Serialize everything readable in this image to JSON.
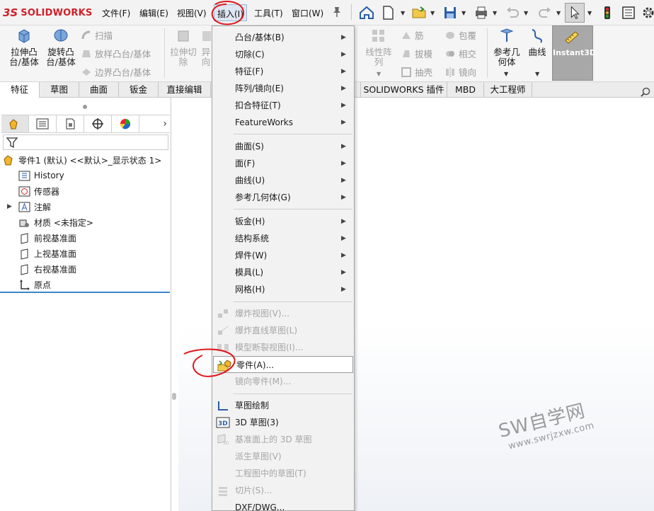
{
  "app": {
    "logo_ds": "3S",
    "logo_word": "SOLIDWORKS"
  },
  "menubar": {
    "items": [
      "文件(F)",
      "编辑(E)",
      "视图(V)",
      "插入(I)",
      "工具(T)",
      "窗口(W)"
    ],
    "active": "插入(I)"
  },
  "ribbon": {
    "extrude_boss": "拉伸凸\n台/基体",
    "revolve_boss": "旋转凸\n台/基体",
    "sweep": "扫描",
    "loft": "放样凸台/基体",
    "boundary": "边界凸台/基体",
    "extrude_cut": "拉伸切\n除",
    "hidden_cut": "异\n向",
    "linear_pattern": "线性阵\n列",
    "rib": "筋",
    "wrap": "包覆",
    "draft": "拔模",
    "intersect": "相交",
    "shell": "抽壳",
    "mirror": "镜向",
    "ref_geometry": "参考几\n何体",
    "curves": "曲线",
    "instant3d": "Instant3D"
  },
  "tabs": [
    "特征",
    "草图",
    "曲面",
    "钣金",
    "直接编辑",
    "",
    "SOLIDWORKS 插件",
    "MBD",
    "大工程师"
  ],
  "tree": {
    "root": "零件1 (默认) <<默认>_显示状态 1>",
    "nodes": [
      "History",
      "传感器",
      "注解",
      "材质 <未指定>",
      "前视基准面",
      "上视基准面",
      "右视基准面",
      "原点"
    ]
  },
  "insert_menu": {
    "groups": [
      [
        {
          "label": "凸台/基体(B)",
          "submenu": true,
          "enabled": true
        },
        {
          "label": "切除(C)",
          "submenu": true,
          "enabled": true
        },
        {
          "label": "特征(F)",
          "submenu": true,
          "enabled": true
        },
        {
          "label": "阵列/镜向(E)",
          "submenu": true,
          "enabled": true
        },
        {
          "label": "扣合特征(T)",
          "submenu": true,
          "enabled": true
        },
        {
          "label": "FeatureWorks",
          "submenu": true,
          "enabled": true
        }
      ],
      [
        {
          "label": "曲面(S)",
          "submenu": true,
          "enabled": true
        },
        {
          "label": "面(F)",
          "submenu": true,
          "enabled": true
        },
        {
          "label": "曲线(U)",
          "submenu": true,
          "enabled": true
        },
        {
          "label": "参考几何体(G)",
          "submenu": true,
          "enabled": true
        }
      ],
      [
        {
          "label": "钣金(H)",
          "submenu": true,
          "enabled": true
        },
        {
          "label": "结构系统",
          "submenu": true,
          "enabled": true
        },
        {
          "label": "焊件(W)",
          "submenu": true,
          "enabled": true
        },
        {
          "label": "模具(L)",
          "submenu": true,
          "enabled": true
        },
        {
          "label": "网格(H)",
          "submenu": true,
          "enabled": true
        }
      ],
      [
        {
          "label": "爆炸视图(V)...",
          "enabled": false
        },
        {
          "label": "爆炸直线草图(L)",
          "enabled": false
        },
        {
          "label": "模型断裂视图(I)...",
          "enabled": false
        },
        {
          "label": "零件(A)...",
          "enabled": true,
          "highlighted": true
        },
        {
          "label": "镜向零件(M)...",
          "enabled": false
        }
      ],
      [
        {
          "label": "草图绘制",
          "enabled": true
        },
        {
          "label": "3D 草图(3)",
          "enabled": true
        },
        {
          "label": "基准面上的 3D 草图",
          "enabled": false
        },
        {
          "label": "派生草图(V)",
          "enabled": false
        },
        {
          "label": "工程图中的草图(T)",
          "enabled": false
        },
        {
          "label": "切片(S)...",
          "enabled": false
        },
        {
          "label": "DXF/DWG...",
          "enabled": true
        }
      ]
    ]
  },
  "watermark": {
    "main": "SW自学网",
    "sub": "www.swrjzxw.com"
  },
  "colors": {
    "accent": "#3d86c6",
    "annotation": "#e0161b",
    "brand": "#d0202a"
  }
}
